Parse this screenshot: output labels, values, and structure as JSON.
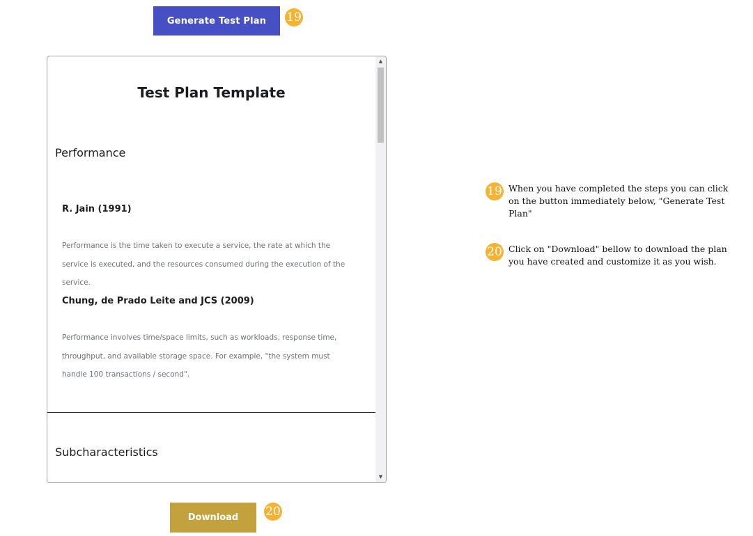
{
  "generate_button": {
    "label": "Generate Test Plan",
    "badge": "19"
  },
  "download_button": {
    "label": "Download",
    "badge": "20"
  },
  "document": {
    "title": "Test Plan Template",
    "sections": {
      "performance": {
        "heading": "Performance",
        "entries": [
          {
            "author": "R. Jain (1991)",
            "text": "Performance is the time taken to execute a service, the rate at which the service is executed, and the resources consumed during the execution of the service."
          },
          {
            "author": "Chung, de Prado Leite and JCS (2009)",
            "text": "Performance involves time/space limits, such as workloads, response time, throughput, and available storage space. For example, \"the system must handle 100 transactions / second\"."
          }
        ]
      },
      "subcharacteristics": {
        "heading": "Subcharacteristics"
      }
    }
  },
  "notes": [
    {
      "badge": "19",
      "text": "When you have completed the steps you can click on the button immediately below, \"Generate Test Plan\""
    },
    {
      "badge": "20",
      "text": "Click on \"Download\" bellow to download the plan you have created and customize it as you wish."
    }
  ],
  "colors": {
    "generate_button": "#4650c4",
    "download_button": "#c3a23e",
    "badge": "#f6b233"
  },
  "icons": {
    "scroll_up": "triangle-up",
    "scroll_down": "triangle-down"
  }
}
